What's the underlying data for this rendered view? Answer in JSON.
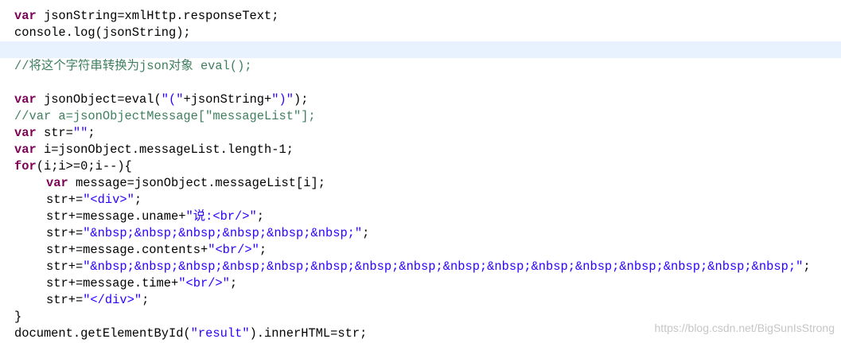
{
  "colors": {
    "keyword": "#7f0055",
    "string": "#2a00ff",
    "comment": "#3f7f5f",
    "current_line": "#e8f2fe"
  },
  "lines": [
    {
      "tokens": [
        {
          "t": "kw",
          "v": "var"
        },
        {
          "t": "p",
          "v": " jsonString=xmlHttp.responseText;"
        }
      ]
    },
    {
      "tokens": [
        {
          "t": "p",
          "v": "console.log(jsonString);"
        }
      ]
    },
    {
      "current": true,
      "tokens": []
    },
    {
      "tokens": [
        {
          "t": "cm",
          "v": "//将这个字符串转换为json对象 eval();"
        }
      ]
    },
    {
      "tokens": []
    },
    {
      "tokens": [
        {
          "t": "kw",
          "v": "var"
        },
        {
          "t": "p",
          "v": " jsonObject=eval("
        },
        {
          "t": "str",
          "v": "\"(\""
        },
        {
          "t": "p",
          "v": "+jsonString+"
        },
        {
          "t": "str",
          "v": "\")\""
        },
        {
          "t": "p",
          "v": ");"
        }
      ]
    },
    {
      "tokens": [
        {
          "t": "cm",
          "v": "//var a=jsonObjectMessage[\"messageList\"];"
        }
      ]
    },
    {
      "tokens": [
        {
          "t": "kw",
          "v": "var"
        },
        {
          "t": "p",
          "v": " str="
        },
        {
          "t": "str",
          "v": "\"\""
        },
        {
          "t": "p",
          "v": ";"
        }
      ]
    },
    {
      "tokens": [
        {
          "t": "kw",
          "v": "var"
        },
        {
          "t": "p",
          "v": " i=jsonObject.messageList.length-1;"
        }
      ]
    },
    {
      "tokens": [
        {
          "t": "kw",
          "v": "for"
        },
        {
          "t": "p",
          "v": "(i;i>=0;i--){"
        }
      ]
    },
    {
      "indent": true,
      "tokens": [
        {
          "t": "kw",
          "v": "var"
        },
        {
          "t": "p",
          "v": " message=jsonObject.messageList[i];"
        }
      ]
    },
    {
      "indent": true,
      "tokens": [
        {
          "t": "p",
          "v": "str+="
        },
        {
          "t": "str",
          "v": "\"<div>\""
        },
        {
          "t": "p",
          "v": ";"
        }
      ]
    },
    {
      "indent": true,
      "tokens": [
        {
          "t": "p",
          "v": "str+=message.uname+"
        },
        {
          "t": "str",
          "v": "\"说:<br/>\""
        },
        {
          "t": "p",
          "v": ";"
        }
      ]
    },
    {
      "indent": true,
      "tokens": [
        {
          "t": "p",
          "v": "str+="
        },
        {
          "t": "str",
          "v": "\"&nbsp;&nbsp;&nbsp;&nbsp;&nbsp;&nbsp;\""
        },
        {
          "t": "p",
          "v": ";"
        }
      ]
    },
    {
      "indent": true,
      "tokens": [
        {
          "t": "p",
          "v": "str+=message.contents+"
        },
        {
          "t": "str",
          "v": "\"<br/>\""
        },
        {
          "t": "p",
          "v": ";"
        }
      ]
    },
    {
      "indent": true,
      "tokens": [
        {
          "t": "p",
          "v": "str+="
        },
        {
          "t": "str",
          "v": "\"&nbsp;&nbsp;&nbsp;&nbsp;&nbsp;&nbsp;&nbsp;&nbsp;&nbsp;&nbsp;&nbsp;&nbsp;&nbsp;&nbsp;&nbsp;&nbsp;\""
        },
        {
          "t": "p",
          "v": ";"
        }
      ]
    },
    {
      "indent": true,
      "tokens": [
        {
          "t": "p",
          "v": "str+=message.time+"
        },
        {
          "t": "str",
          "v": "\"<br/>\""
        },
        {
          "t": "p",
          "v": ";"
        }
      ]
    },
    {
      "indent": true,
      "tokens": [
        {
          "t": "p",
          "v": "str+="
        },
        {
          "t": "str",
          "v": "\"</div>\""
        },
        {
          "t": "p",
          "v": ";"
        }
      ]
    },
    {
      "tokens": [
        {
          "t": "p",
          "v": "}"
        }
      ]
    },
    {
      "tokens": [
        {
          "t": "p",
          "v": "document.getElementById("
        },
        {
          "t": "str",
          "v": "\"result\""
        },
        {
          "t": "p",
          "v": ").innerHTML=str;"
        }
      ]
    }
  ],
  "watermark": "https://blog.csdn.net/BigSunIsStrong"
}
